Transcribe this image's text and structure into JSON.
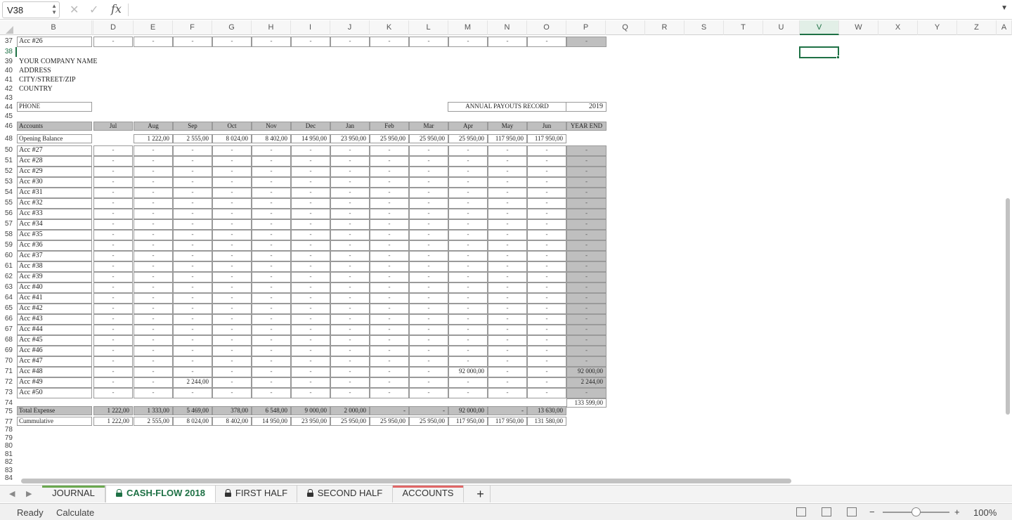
{
  "formula_bar": {
    "cell_ref": "V38",
    "fx_label": "fx"
  },
  "columns": [
    "B",
    "",
    "D",
    "E",
    "F",
    "G",
    "H",
    "I",
    "J",
    "K",
    "L",
    "M",
    "N",
    "O",
    "P",
    "Q",
    "R",
    "S",
    "T",
    "U",
    "V",
    "W",
    "X",
    "Y",
    "Z",
    "A"
  ],
  "selected_column": "V",
  "selected_cell": "V38",
  "rows_top": {
    "r37": {
      "num": "37",
      "label": "Acc #26"
    },
    "r38": {
      "num": "38"
    },
    "r39": {
      "num": "39",
      "label": "YOUR COMPANY NAME"
    },
    "r40": {
      "num": "40",
      "label": "ADDRESS"
    },
    "r41": {
      "num": "41",
      "label": "CITY/STREET/ZIP"
    },
    "r42": {
      "num": "42",
      "label": "COUNTRY"
    },
    "r43": {
      "num": "43"
    },
    "r44": {
      "num": "44",
      "label": "PHONE"
    },
    "r45": {
      "num": "45"
    },
    "r46": {
      "num": "46"
    },
    "r48": {
      "num": "48"
    }
  },
  "record": {
    "title": "ANNUAL PAYOUTS RECORD",
    "year": "2019"
  },
  "table_header": {
    "accounts": "Accounts",
    "months": [
      "Jul",
      "Aug",
      "Sep",
      "Oct",
      "Nov",
      "Dec",
      "Jan",
      "Feb",
      "Mar",
      "Apr",
      "May",
      "Jun"
    ],
    "year_end": "YEAR END"
  },
  "opening_balance": {
    "label": "Opening Balance",
    "values": [
      "",
      "1 222,00",
      "2 555,00",
      "8 024,00",
      "8 402,00",
      "14 950,00",
      "23 950,00",
      "25 950,00",
      "25 950,00",
      "25 950,00",
      "117 950,00",
      "117 950,00"
    ]
  },
  "account_rows": [
    {
      "num": "50",
      "label": "Acc #27"
    },
    {
      "num": "51",
      "label": "Acc #28"
    },
    {
      "num": "52",
      "label": "Acc #29"
    },
    {
      "num": "53",
      "label": "Acc #30"
    },
    {
      "num": "54",
      "label": "Acc #31"
    },
    {
      "num": "55",
      "label": "Acc #32"
    },
    {
      "num": "56",
      "label": "Acc #33"
    },
    {
      "num": "57",
      "label": "Acc #34"
    },
    {
      "num": "58",
      "label": "Acc #35"
    },
    {
      "num": "59",
      "label": "Acc #36"
    },
    {
      "num": "60",
      "label": "Acc #37"
    },
    {
      "num": "61",
      "label": "Acc #38"
    },
    {
      "num": "62",
      "label": "Acc #39"
    },
    {
      "num": "63",
      "label": "Acc #40"
    },
    {
      "num": "64",
      "label": "Acc #41"
    },
    {
      "num": "65",
      "label": "Acc #42"
    },
    {
      "num": "66",
      "label": "Acc #43"
    },
    {
      "num": "67",
      "label": "Acc #44"
    },
    {
      "num": "68",
      "label": "Acc #45"
    },
    {
      "num": "69",
      "label": "Acc #46"
    },
    {
      "num": "70",
      "label": "Acc #47"
    },
    {
      "num": "71",
      "label": "Acc #48",
      "values": {
        "9": "92 000,00"
      },
      "year_end": "92 000,00"
    },
    {
      "num": "72",
      "label": "Acc #49",
      "values": {
        "2": "2 244,00"
      },
      "year_end": "2 244,00"
    },
    {
      "num": "73",
      "label": "Acc #50"
    }
  ],
  "dash": "-",
  "grand_total": {
    "num": "74",
    "value": "133 599,00"
  },
  "total_expense": {
    "num": "75",
    "label": "Total Expense",
    "values": [
      "1 222,00",
      "1 333,00",
      "5 469,00",
      "378,00",
      "6 548,00",
      "9 000,00",
      "2 000,00",
      "-",
      "-",
      "92 000,00",
      "-",
      "13 630,00"
    ]
  },
  "cumulative": {
    "num": "77",
    "label": "Cummulative",
    "values": [
      "1 222,00",
      "2 555,00",
      "8 024,00",
      "8 402,00",
      "14 950,00",
      "23 950,00",
      "25 950,00",
      "25 950,00",
      "25 950,00",
      "117 950,00",
      "117 950,00",
      "131 580,00"
    ]
  },
  "empty_rows": [
    "78",
    "79",
    "80",
    "81",
    "82",
    "83",
    "84"
  ],
  "sheet_tabs": [
    {
      "label": "JOURNAL",
      "locked": false,
      "active": false,
      "accent": "#6aa84f"
    },
    {
      "label": "CASH-FLOW 2018",
      "locked": true,
      "active": true,
      "accent": ""
    },
    {
      "label": "FIRST HALF",
      "locked": true,
      "active": false,
      "accent": ""
    },
    {
      "label": "SECOND HALF",
      "locked": true,
      "active": false,
      "accent": ""
    },
    {
      "label": "ACCOUNTS",
      "locked": false,
      "active": false,
      "accent": "#e06666"
    }
  ],
  "add_sheet": "+",
  "status": {
    "ready": "Ready",
    "calculate": "Calculate",
    "zoom": "100%",
    "zoom_minus": "−",
    "zoom_plus": "+"
  }
}
